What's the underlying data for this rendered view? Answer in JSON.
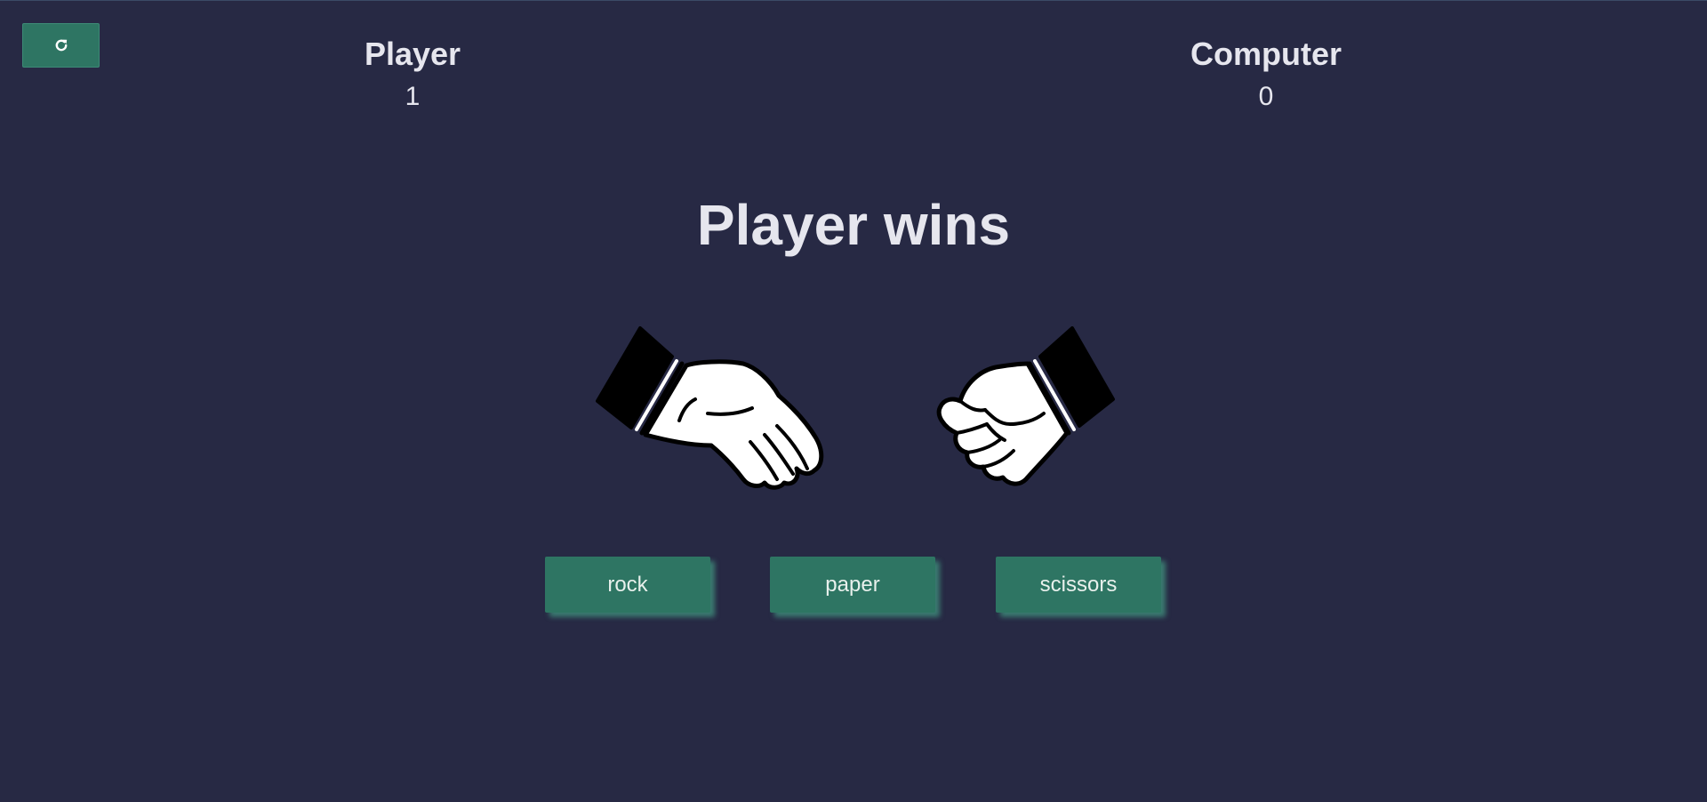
{
  "controls": {
    "reset_icon": "refresh-icon"
  },
  "scoreboard": {
    "player": {
      "title": "Player",
      "score": "1"
    },
    "computer": {
      "title": "Computer",
      "score": "0"
    }
  },
  "result": {
    "text": "Player wins"
  },
  "hands": {
    "player_choice": "paper",
    "computer_choice": "rock"
  },
  "choices": [
    {
      "label": "rock"
    },
    {
      "label": "paper"
    },
    {
      "label": "scissors"
    }
  ],
  "colors": {
    "background": "#272944",
    "button": "#2e7563",
    "button_glow": "#4abe96",
    "text": "#e6e6ee"
  }
}
